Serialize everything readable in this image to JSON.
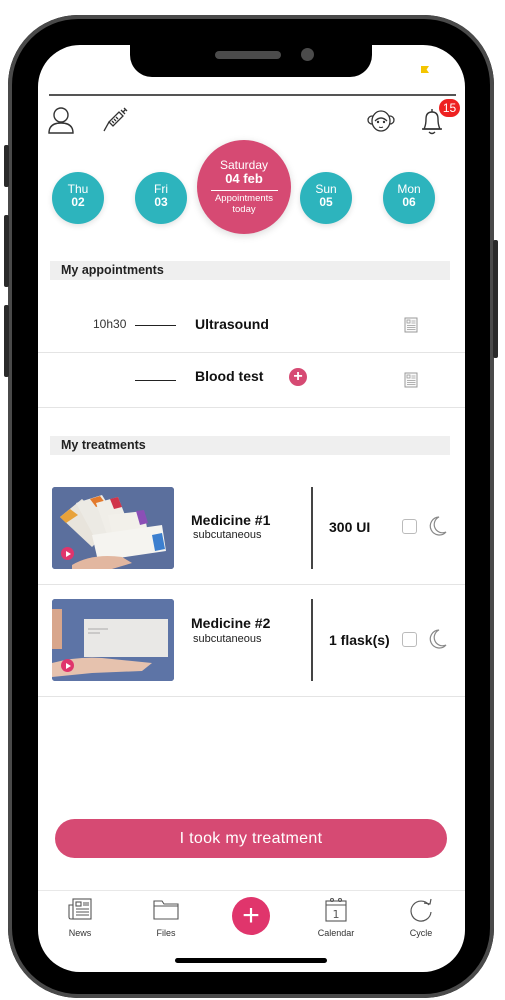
{
  "header": {
    "notification_count": "15",
    "icons": [
      "user-icon",
      "syringe-icon",
      "monkey-face-icon",
      "bell-icon"
    ]
  },
  "calendar": {
    "days": [
      {
        "name": "Thu",
        "date": "02"
      },
      {
        "name": "Fri",
        "date": "03"
      },
      {
        "name": "Sun",
        "date": "05"
      },
      {
        "name": "Mon",
        "date": "06"
      }
    ],
    "today": {
      "name": "Saturday",
      "date": "04 feb",
      "subtitle_line1": "Appointments",
      "subtitle_line2": "today"
    },
    "colors": {
      "day": "#2db4bd",
      "today": "#d64a73"
    }
  },
  "appointments": {
    "title": "My appointments",
    "items": [
      {
        "time": "10h30",
        "name": "Ultrasound",
        "has_add": false
      },
      {
        "time": "",
        "name": "Blood test",
        "has_add": true
      }
    ]
  },
  "treatments": {
    "title": "My treatments",
    "items": [
      {
        "name": "Medicine #1",
        "route": "subcutaneous",
        "dose": "300 UI",
        "checked": false
      },
      {
        "name": "Medicine #2",
        "route": "subcutaneous",
        "dose": "1 flask(s)",
        "checked": false
      }
    ]
  },
  "cta": {
    "label": "I took my treatment",
    "color": "#d64a73"
  },
  "tabbar": {
    "items": [
      {
        "label": "News",
        "icon": "newspaper-icon"
      },
      {
        "label": "Files",
        "icon": "folder-icon"
      },
      {
        "label": "",
        "icon": "plus-icon"
      },
      {
        "label": "Calendar",
        "icon": "calendar-icon"
      },
      {
        "label": "Cycle",
        "icon": "refresh-icon"
      }
    ]
  }
}
